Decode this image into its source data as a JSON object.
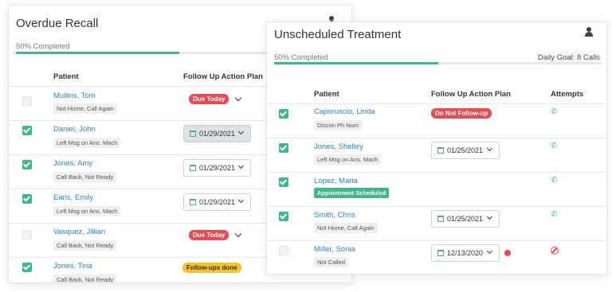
{
  "overdue_recall": {
    "title": "Overdue Recall",
    "progress_label": "50% Completed",
    "progress_fraction": 0.5,
    "columns": {
      "patient": "Patient",
      "action": "Follow Up Action Plan"
    },
    "rows": [
      {
        "name": "Mullins, Tom",
        "note": "Not Home, Call Again",
        "checked": false,
        "action": {
          "type": "badge",
          "text": "Due Today",
          "color": "red",
          "chevron": true
        }
      },
      {
        "name": "Daniel, John",
        "note": "Left Msg on Ans. Mach",
        "checked": true,
        "action": {
          "type": "date",
          "text": "01/29/2021",
          "style": "gray"
        }
      },
      {
        "name": "Jones, Amy",
        "note": "Call Back, Not Ready",
        "checked": true,
        "action": {
          "type": "date",
          "text": "01/29/2021",
          "style": "white"
        }
      },
      {
        "name": "Earls, Emily",
        "note": "Left Msg on Ans. Mach",
        "checked": true,
        "action": {
          "type": "date",
          "text": "01/29/2021",
          "style": "white"
        }
      },
      {
        "name": "Vasquez, Jillian",
        "note": "Call Back, Not Ready",
        "checked": false,
        "action": {
          "type": "badge",
          "text": "Due Today",
          "color": "red",
          "chevron": true
        }
      },
      {
        "name": "Jones, Tina",
        "note": "Call Back, Not Ready",
        "checked": true,
        "action": {
          "type": "badge",
          "text": "Follow-ups done",
          "color": "yellow",
          "chevron": false
        }
      }
    ]
  },
  "unscheduled_treatment": {
    "title": "Unscheduled Treatment",
    "progress_label": "50% Completed",
    "progress_fraction": 0.5,
    "daily_goal": "Daily Goal: 8 Calls",
    "columns": {
      "patient": "Patient",
      "action": "Follow Up Action Plan",
      "attempts": "Attempts"
    },
    "rows": [
      {
        "name": "Caporuscio, Linda",
        "note": "Discon Ph Num",
        "note_style": "gray",
        "checked": true,
        "action": {
          "type": "badge",
          "text": "Do Not Follow-up",
          "color": "red"
        },
        "attempt": "phone"
      },
      {
        "name": "Jones, Shelley",
        "note": "Left Msg on Ans. Mach",
        "note_style": "gray",
        "checked": true,
        "action": {
          "type": "date",
          "text": "01/25/2021"
        },
        "attempt": "phone"
      },
      {
        "name": "Lopez, Maria",
        "note": "Appointment Scheduled",
        "note_style": "green",
        "checked": true,
        "action": {
          "type": "none"
        },
        "attempt": "phone"
      },
      {
        "name": "Smith, Chris",
        "note": "Not Home, Call Again",
        "note_style": "gray",
        "checked": true,
        "action": {
          "type": "date",
          "text": "01/25/2021"
        },
        "attempt": "phone"
      },
      {
        "name": "Miller, Sonia",
        "note": "Not Called",
        "note_style": "gray",
        "checked": false,
        "action": {
          "type": "date",
          "text": "12/13/2020",
          "dot": "red"
        },
        "attempt": "no-call"
      }
    ]
  },
  "icons": {
    "user": "user-icon",
    "calendar": "calendar-icon",
    "phone": "phone-icon",
    "no_call": "no-call-icon",
    "chevron": "chevron-down-icon"
  },
  "colors": {
    "accent": "#3fb68b",
    "link": "#2a82c8",
    "danger": "#e74c55",
    "warning": "#f4c430"
  }
}
